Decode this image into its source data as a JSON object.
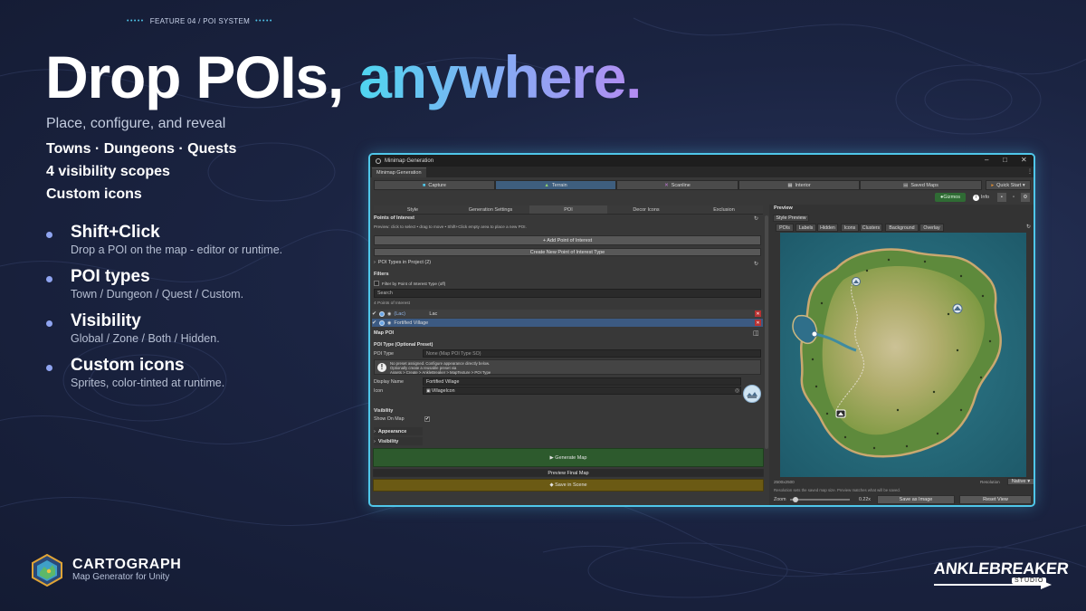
{
  "eyebrow": {
    "dots_left": "•••••",
    "text": "FEATURE 04 / POI SYSTEM",
    "dots_right": "•••••"
  },
  "headline": {
    "part1": "Drop POIs,",
    "part2": "anywhere."
  },
  "subtitle": "Place, configure, and reveal",
  "highlights": [
    "Towns · Dungeons · Quests",
    "4 visibility scopes",
    "Custom icons"
  ],
  "bullets": [
    {
      "title": "Shift+Click",
      "desc": "Drop a POI on the map - editor or runtime."
    },
    {
      "title": "POI types",
      "desc": "Town / Dungeon / Quest / Custom."
    },
    {
      "title": "Visibility",
      "desc": "Global / Zone / Both / Hidden."
    },
    {
      "title": "Custom icons",
      "desc": "Sprites, color-tinted at runtime."
    }
  ],
  "brand": {
    "name": "CARTOGRAPH",
    "tagline": "Map Generator for Unity"
  },
  "studio": {
    "name": "ANKLEBREAKER",
    "sub": "STUDIO"
  },
  "colors": {
    "accent_cyan": "#4fc7ea",
    "gradient_end": "#b48cf2",
    "background": "#1b2442",
    "generate_green": "#2d5a2d",
    "save_gold": "#6b5a14"
  },
  "window": {
    "title": "Minimap Generation",
    "tab": "Minimap Generation",
    "modes": [
      {
        "label": "Capture",
        "icon": "camera-icon"
      },
      {
        "label": "Terrain",
        "icon": "terrain-icon"
      },
      {
        "label": "Scanline",
        "icon": "scanline-icon"
      },
      {
        "label": "Interior",
        "icon": "interior-icon"
      },
      {
        "label": "Saved Maps",
        "icon": "folder-icon"
      }
    ],
    "quick_start": "Quick Start ▾",
    "gizmos": "Gizmos",
    "info": "Info",
    "sub_tabs": [
      "Style",
      "Generation Settings",
      "POI",
      "Decor Icons",
      "Exclusion"
    ],
    "poi_panel": {
      "header": "Points of Interest",
      "hint": "Preview: click to select • drag to move • Shift+Click empty area to place a new POI.",
      "add_button": "+ Add Point of Interest",
      "create_button": "Create New Point of Interest Type",
      "types_foldout": "POI Types in Project (2)",
      "filters_header": "Filters",
      "filter_toggle": "Filter by Point of Interest Type (off)",
      "search_label": "Search",
      "count_label": "4 Points of Interest",
      "rows": [
        {
          "tag": "(Lac)",
          "name": "Lac"
        },
        {
          "tag": "",
          "name": "Fortified Village"
        }
      ]
    },
    "map_poi": {
      "header": "Map POI",
      "type_header": "POI Type (Optional Preset)",
      "type_label": "POI Type",
      "type_value": "None (Map POI Type SO)",
      "info_line1": "No preset assigned. Configure appearance directly below.",
      "info_line2": "Optionally create a reusable preset via",
      "info_line3": "Assets > Create > AnkleBreaker > MapTexture > POI Type",
      "display_label": "Display Name",
      "display_value": "Fortified Village",
      "icon_label": "Icon",
      "icon_value": "VillageIcon",
      "visibility_header": "Visibility",
      "show_label": "Show On Map",
      "appearance_foldout": "Appearance",
      "visibility_foldout": "Visibility"
    },
    "actions": {
      "generate": "▶ Generate Map",
      "preview": "Preview Final Map",
      "save": "◆ Save in Scene"
    },
    "preview": {
      "header": "Preview",
      "style_tab": "Style Preview",
      "toggles": [
        "POIs",
        "Labels",
        "Hidden",
        "Icons",
        "Clusters",
        "Background",
        "Overlay"
      ],
      "size": "2500x2500",
      "resolution_label": "Resolution",
      "resolution_value": "Native",
      "note": "Resolution sets the saved map size. Preview matches what will be saved.",
      "zoom_label": "Zoom",
      "zoom_value": "0.22x",
      "zoom_level": 0.05,
      "save_image": "Save as Image",
      "reset_view": "Reset View"
    }
  }
}
